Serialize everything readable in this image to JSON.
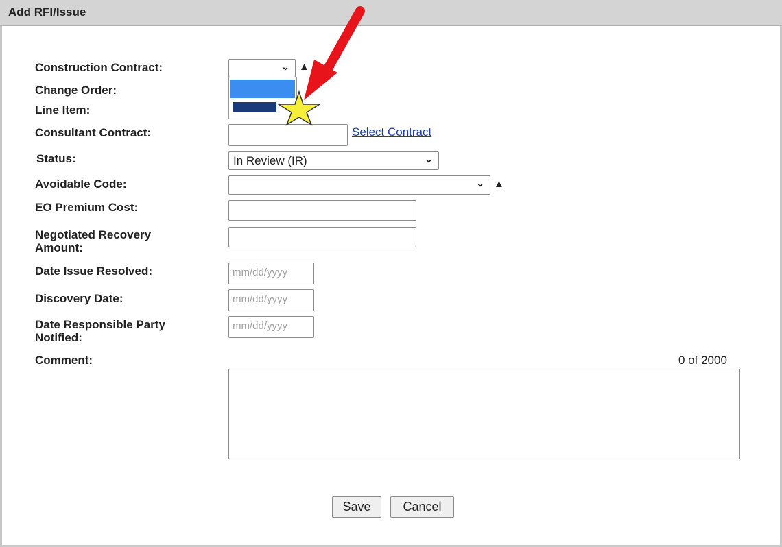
{
  "dialog": {
    "title": "Add RFI/Issue"
  },
  "form": {
    "construction_contract_label": "Construction Contract:",
    "change_order_label": "Change Order:",
    "line_item_label": "Line Item:",
    "consultant_contract_label": "Consultant Contract:",
    "consultant_contract_value": "",
    "select_contract_link": "Select Contract",
    "status_label": "Status:",
    "status_value": "In Review (IR)",
    "avoidable_code_label": "Avoidable Code:",
    "avoidable_code_value": "",
    "eo_premium_cost_label": "EO Premium Cost:",
    "eo_premium_cost_value": "",
    "negotiated_recovery_label_line1": "Negotiated Recovery",
    "negotiated_recovery_label_line2": "Amount:",
    "negotiated_recovery_value": "",
    "date_issue_resolved_label": "Date Issue Resolved:",
    "discovery_date_label": "Discovery Date:",
    "date_responsible_label_line1": "Date Responsible Party",
    "date_responsible_label_line2": "Notified:",
    "date_placeholder": "mm/dd/yyyy",
    "comment_label": "Comment:",
    "comment_counter": "0 of 2000",
    "comment_value": ""
  },
  "buttons": {
    "save": "Save",
    "cancel": "Cancel"
  },
  "icons": {
    "dropdown": "chevron-down-icon",
    "warning": "warning-icon"
  },
  "annotations": {
    "arrow_color": "#e8141b",
    "star_color": "#f5ef3a"
  },
  "colors": {
    "selected_option": "#3b8df0",
    "option_highlight": "#1a3a7a",
    "link": "#1a3fb0"
  }
}
